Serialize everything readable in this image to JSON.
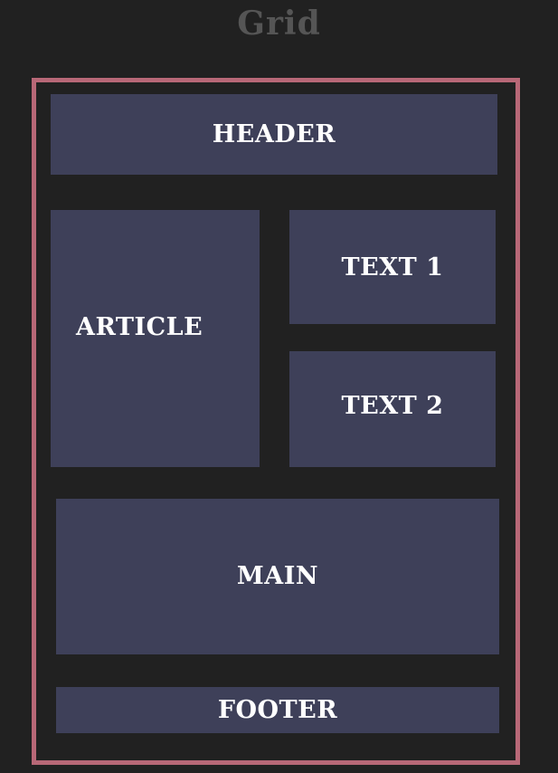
{
  "title": "Grid",
  "colors": {
    "background": "#212121",
    "frame_border": "#b86877",
    "cell_fill": "#3e4059",
    "cell_text": "#ffffff",
    "title_text": "#555555"
  },
  "cells": {
    "header": "HEADER",
    "article": "ARTICLE",
    "text1": "TEXT 1",
    "text2": "TEXT 2",
    "main": "MAIN",
    "footer": "FOOTER"
  }
}
